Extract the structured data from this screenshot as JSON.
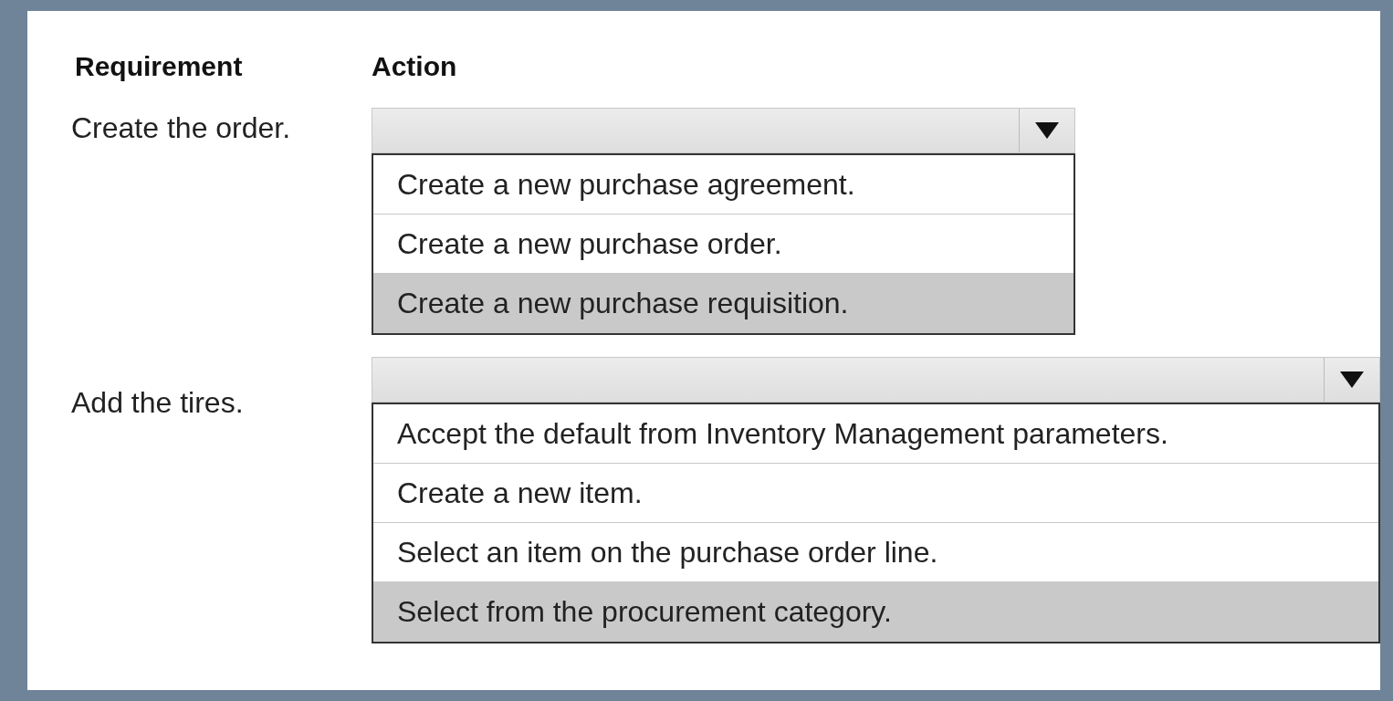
{
  "headers": [
    "Requirement",
    "Action"
  ],
  "rows": [
    {
      "requirement": "Create the order.",
      "options": [
        {
          "label": "Create a new purchase agreement.",
          "selected": false
        },
        {
          "label": "Create a new purchase order.",
          "selected": false
        },
        {
          "label": "Create a new purchase requisition.",
          "selected": true
        }
      ]
    },
    {
      "requirement": "Add the tires.",
      "options": [
        {
          "label": "Accept the default from Inventory Management parameters.",
          "selected": false
        },
        {
          "label": "Create a new item.",
          "selected": false
        },
        {
          "label": "Select an item on the purchase order line.",
          "selected": false
        },
        {
          "label": "Select from the procurement category.",
          "selected": true
        }
      ]
    }
  ]
}
